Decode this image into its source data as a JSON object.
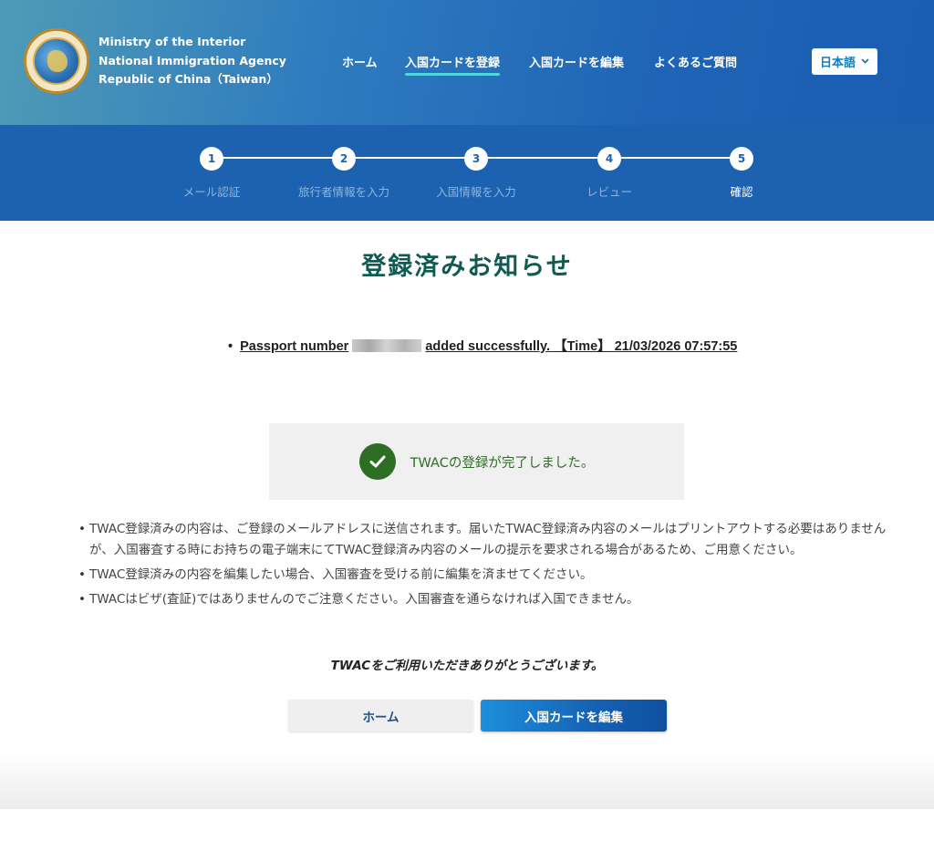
{
  "header": {
    "agency_line1": "Ministry of the Interior",
    "agency_line2": "National Immigration Agency",
    "agency_line3": "Republic of China（Taiwan）",
    "logo_icon": "national-immigration-agency-seal",
    "nav": [
      {
        "label": "ホーム"
      },
      {
        "label": "入国カードを登録"
      },
      {
        "label": "入国カードを編集"
      },
      {
        "label": "よくあるご質問"
      }
    ],
    "active_nav": "入国カードを登録",
    "language": "日本語"
  },
  "stepper": {
    "steps": [
      {
        "number": "1",
        "label": "メール認証"
      },
      {
        "number": "2",
        "label": "旅行者情報を入力"
      },
      {
        "number": "3",
        "label": "入国情報を入力"
      },
      {
        "number": "4",
        "label": "レビュー"
      },
      {
        "number": "5",
        "label": "確認"
      }
    ],
    "current_step": 5
  },
  "main": {
    "title": "登録済みお知らせ",
    "success_prefix": "Passport number",
    "success_suffix": "added successfully.",
    "time_label": "【Time】",
    "time_value": "21/03/2026 07:57:55",
    "done_message": "TWACの登録が完了しました。",
    "notes": [
      "TWAC登録済みの内容は、ご登録のメールアドレスに送信されます。届いたTWAC登録済み内容のメールはプリントアウトする必要はありませんが、入国審査する時にお持ちの電子端末にてTWAC登録済み内容のメールの提示を要求される場合があるため、ご用意ください。",
      "TWAC登録済みの内容を編集したい場合、入国審査を受ける前に編集を済ませてください。",
      "TWACはビザ(査証)ではありませんのでご注意ください。入国審査を通らなければ入国できません。"
    ],
    "thanks": "TWACをご利用いただきありがとうございます。",
    "buttons": {
      "home": "ホーム",
      "edit": "入国カードを編集"
    }
  },
  "colors": {
    "header_blue": "#1c62b0",
    "title_green": "#0f5a52",
    "success_green": "#2e6e24",
    "active_underline": "#4fd6e0"
  }
}
